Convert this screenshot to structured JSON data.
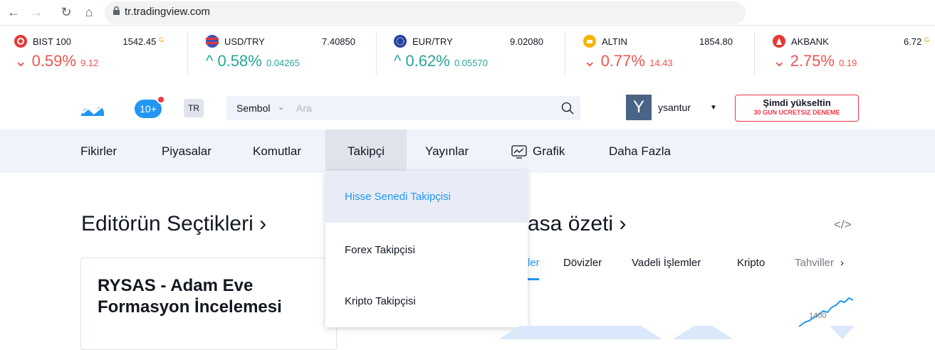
{
  "browser": {
    "url": "tr.tradingview.com"
  },
  "tickers": [
    {
      "name": "BIST 100",
      "value": "1542.45",
      "suffix": "G",
      "change_pct": "0.59%",
      "change_abs": "9.12",
      "direction": "down",
      "flag_color": "#e53935"
    },
    {
      "name": "USD/TRY",
      "value": "7.40850",
      "suffix": "",
      "change_pct": "0.58%",
      "change_abs": "0.04265",
      "direction": "up",
      "flag_color": "#3f51b5"
    },
    {
      "name": "EUR/TRY",
      "value": "9.02080",
      "suffix": "",
      "change_pct": "0.62%",
      "change_abs": "0.05570",
      "direction": "up",
      "flag_color": "#1e40af"
    },
    {
      "name": "ALTIN",
      "value": "1854.80",
      "suffix": "",
      "change_pct": "0.77%",
      "change_abs": "14.43",
      "direction": "down",
      "flag_color": "#f4b400"
    },
    {
      "name": "AKBANK",
      "value": "6.72",
      "suffix": "G",
      "change_pct": "2.75%",
      "change_abs": "0.19",
      "direction": "down",
      "flag_color": "#e53935"
    }
  ],
  "header": {
    "notifications": "10+",
    "language": "TR",
    "search_symbol": "Sembol",
    "search_placeholder": "Ara",
    "avatar_letter": "Y",
    "username": "ysantur",
    "upgrade_main": "Şimdi yükseltin",
    "upgrade_sub": "30 GUN UCRETSIZ DENEME"
  },
  "nav": {
    "items": [
      "Fikirler",
      "Piyasalar",
      "Komutlar",
      "Takipçi",
      "Yayınlar",
      "Grafik",
      "Daha Fazla"
    ],
    "active": "Takipçi"
  },
  "dropdown": {
    "items": [
      "Hisse Senedi Takipçisi",
      "Forex Takipçisi",
      "Kripto Takipçisi"
    ],
    "active": "Hisse Senedi Takipçisi"
  },
  "main": {
    "editors_heading": "Editörün Seçtikleri ›",
    "summary_heading": "asa özeti ›",
    "embed_symbol": "</>",
    "card_title": "RYSAS - Adam Eve Formasyon İncelemesi",
    "market_tabs": [
      "ler",
      "Dövizler",
      "Vadeli İşlemler",
      "Kripto",
      "Tahviller"
    ],
    "active_tab": "ler",
    "chart_label": "1400"
  },
  "colors": {
    "up": "#26a69a",
    "down": "#ef5350",
    "accent": "#2196f3",
    "upgrade_border": "#f23645",
    "nav_bg": "#f0f3fa"
  }
}
